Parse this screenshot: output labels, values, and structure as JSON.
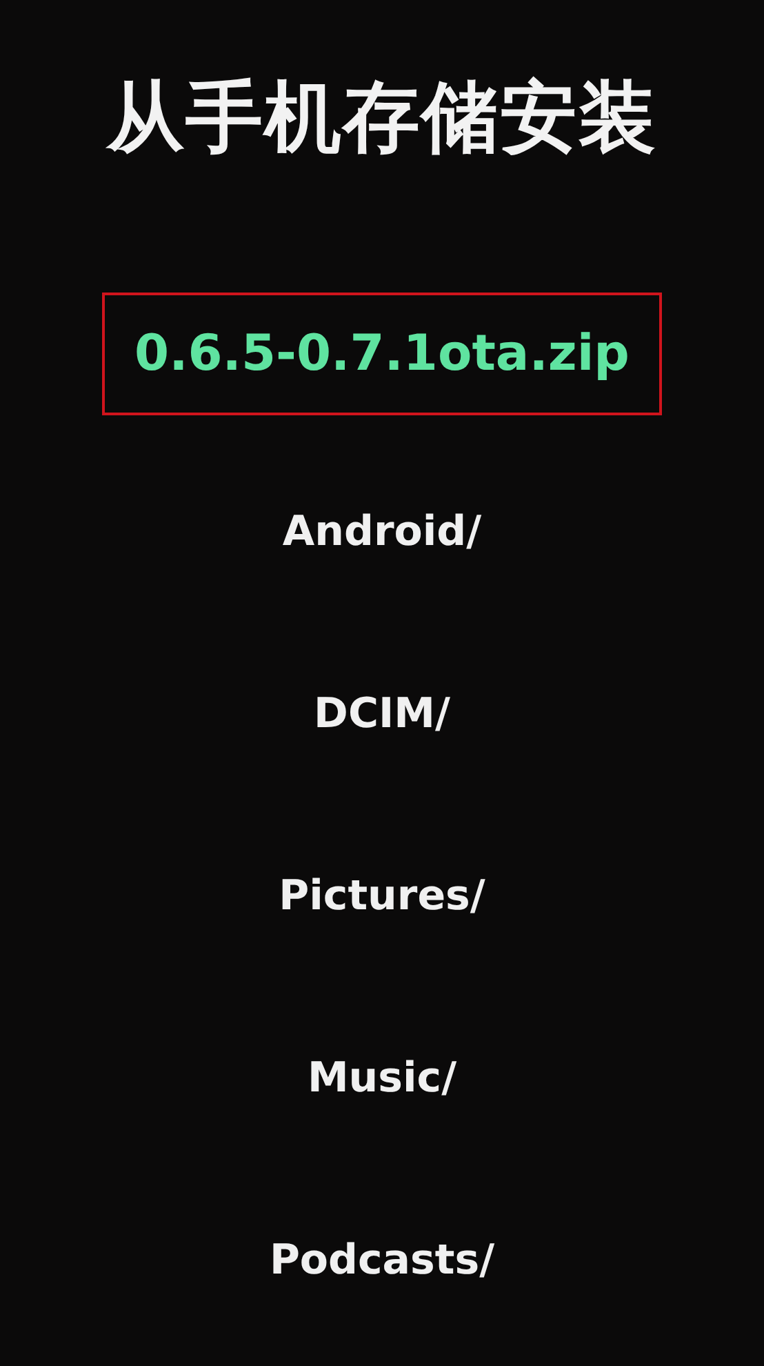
{
  "title": "从手机存储安装",
  "files": [
    {
      "name": "0.6.5-0.7.1ota.zip",
      "selected": true
    },
    {
      "name": "Android/",
      "selected": false
    },
    {
      "name": "DCIM/",
      "selected": false
    },
    {
      "name": "Pictures/",
      "selected": false
    },
    {
      "name": "Music/",
      "selected": false
    },
    {
      "name": "Podcasts/",
      "selected": false
    }
  ]
}
